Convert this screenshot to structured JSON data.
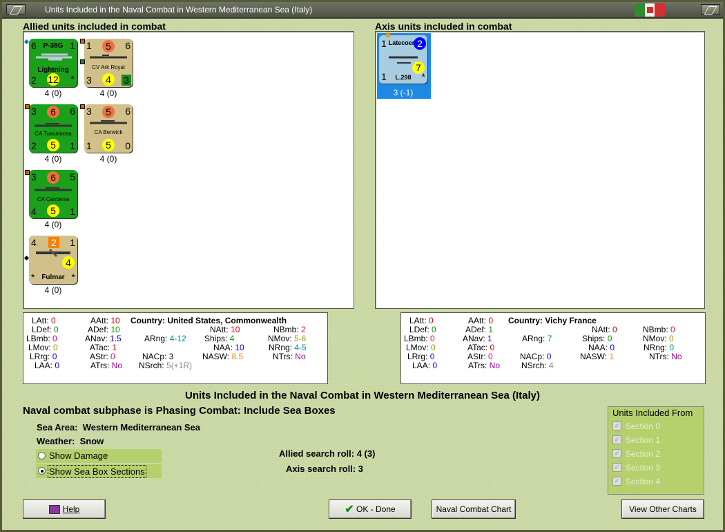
{
  "window": {
    "title": "Units Included in the Naval Combat in Western Mediterranean Sea (Italy)"
  },
  "allied": {
    "panel_title": "Allied units included in combat",
    "units": [
      {
        "tl": "6",
        "name": "P-38G",
        "tr": "1",
        "sub": "Lightning",
        "bl": "2",
        "center": "12",
        "br": "*",
        "below": "4 (0)",
        "color": "#1aa01a"
      },
      {
        "tl": "1",
        "top_circle": "5",
        "tr": "6",
        "name": "CV Ark Royal",
        "bl": "3",
        "center": "4",
        "br": "3",
        "below": "4 (0)",
        "color": "#d2c08a"
      },
      {
        "tl": "3",
        "top_circle": "6",
        "tr": "6",
        "name": "CA Tuscaloosa",
        "bl": "2",
        "center": "5",
        "br": "1",
        "below": "4 (0)",
        "color": "#1aa01a"
      },
      {
        "tl": "3",
        "top_circle": "5",
        "tr": "6",
        "name": "CA Berwick",
        "bl": "1",
        "center": "5",
        "br": "0",
        "below": "4 (0)",
        "color": "#d2c08a"
      },
      {
        "tl": "3",
        "top_circle": "6",
        "tr": "5",
        "name": "CA Canberra",
        "bl": "4",
        "center": "5",
        "br": "1",
        "below": "4 (0)",
        "color": "#1aa01a"
      },
      {
        "tl": "4",
        "top_box": "2",
        "tr": "1",
        "name": "Fulmar",
        "bl": "*",
        "center": "4",
        "br": "*",
        "below": "4 (0)",
        "color": "#d2c08a"
      }
    ],
    "stats": {
      "country_label": "Country:",
      "country": "United States, Commonwealth",
      "LAtt": "0",
      "AAtt": "10",
      "NAtt": "10",
      "NBmb": "2",
      "LDef": "0",
      "ADef": "10",
      "Ships": "4",
      "NMov": "5-6",
      "LBmb": "0",
      "ANav": "1.5",
      "ARng": "4-12",
      "NAA": "10",
      "NRng": "4-5",
      "LMov": "0",
      "ATac": "1",
      "NASW": "8.5",
      "NTrs": "No",
      "LRrg": "0",
      "AStr": "0",
      "NACp": "3",
      "NSrch": "5(+1R)",
      "LAA": "0",
      "ATrs": "No"
    }
  },
  "axis": {
    "panel_title": "Axis units included in combat",
    "units": [
      {
        "tl": "1",
        "name": "Latecoere",
        "tr_circle": "2",
        "center": "7",
        "bl": "1",
        "sub": "L.298",
        "br": "*",
        "below": "3 (-1)"
      }
    ],
    "stats": {
      "country_label": "Country:",
      "country": "Vichy France",
      "LAtt": "0",
      "AAtt": "0",
      "NAtt": "0",
      "NBmb": "0",
      "LDef": "0",
      "ADef": "1",
      "Ships": "0",
      "NMov": "0",
      "LBmb": "0",
      "ANav": "1",
      "ARng": "7",
      "NAA": "0",
      "NRng": "0",
      "LMov": "0",
      "ATac": "0",
      "NASW": "1",
      "NTrs": "No",
      "LRrg": "0",
      "AStr": "0",
      "NACp": "0",
      "NSrch": "4",
      "LAA": "0",
      "ATrs": "No"
    }
  },
  "main": {
    "heading": "Units Included in the Naval Combat in Western Mediterranean Sea (Italy)",
    "subphase": "Naval combat subphase is Phasing Combat: Include Sea Boxes",
    "sea_area_label": "Sea Area:",
    "sea_area": "Western Mediterranean Sea",
    "weather_label": "Weather:",
    "weather": "Snow",
    "show_damage": "Show Damage",
    "show_sea_box": "Show Sea Box Sections",
    "allied_roll_label": "Allied search roll:",
    "allied_roll": "4 (3)",
    "axis_roll_label": "Axis search roll:",
    "axis_roll": "3"
  },
  "sections": {
    "title": "Units Included From",
    "items": [
      "Section 0",
      "Section 1",
      "Section 2",
      "Section 3",
      "Section 4"
    ]
  },
  "buttons": {
    "help": "Help",
    "ok": "OK - Done",
    "naval_chart": "Naval Combat Chart",
    "view_charts": "View Other Charts"
  }
}
